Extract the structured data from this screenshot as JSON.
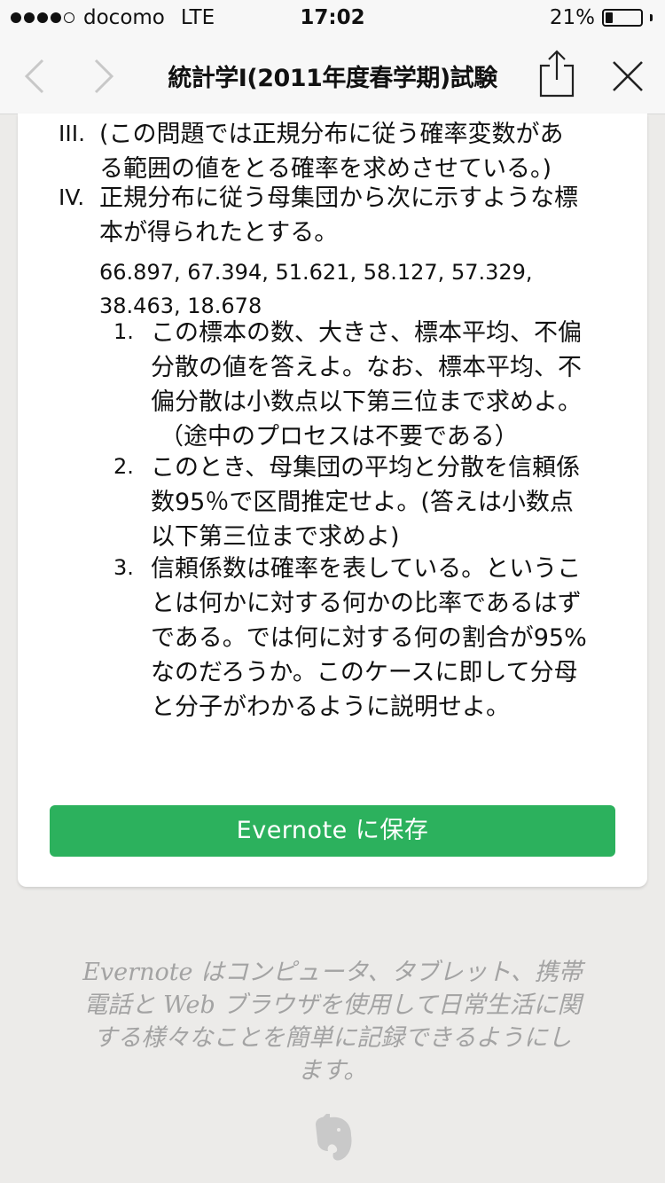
{
  "status_bar": {
    "carrier": "docomo",
    "network": "LTE",
    "time": "17:02",
    "battery_percent": "21%",
    "battery_level": 0.21,
    "signal_bars": 4,
    "signal_total": 5
  },
  "nav": {
    "title": "統計学I(2011年度春学期)試験"
  },
  "items": {
    "iii": {
      "label": "III.",
      "lines": [
        "(この問題では正規分布に従う確率変数があ",
        "る範囲の値をとる確率を求めさせている。)"
      ]
    },
    "iv": {
      "label": "IV.",
      "lines": [
        "正規分布に従う母集団から次に示すような標",
        "本が得られたとする。"
      ],
      "samples": [
        "66.897, 67.394, 51.621, 58.127, 57.329,",
        "38.463, 18.678"
      ],
      "sub": [
        {
          "label": "1.",
          "lines": [
            "この標本の数、大きさ、標本平均、不偏",
            "分散の値を答えよ。なお、標本平均、不",
            "偏分散は小数点以下第三位まで求めよ。",
            "（途中のプロセスは不要である）"
          ]
        },
        {
          "label": "2.",
          "lines": [
            "このとき、母集団の平均と分散を信頼係",
            "数95％で区間推定せよ。(答えは小数点",
            "以下第三位まで求めよ)"
          ]
        },
        {
          "label": "3.",
          "lines": [
            "信頼係数は確率を表している。というこ",
            "とは何かに対する何かの比率であるはず",
            "である。では何に対する何の割合が95%",
            "なのだろうか。このケースに即して分母",
            "と分子がわかるように説明せよ。"
          ]
        }
      ]
    }
  },
  "save_button": {
    "label": "Evernote に保存"
  },
  "footer": {
    "lines": [
      "Evernote はコンピュータ、タブレット、携帯",
      "電話と Web ブラウザを使用して日常生活に関",
      "する様々なことを簡単に記録できるようにし",
      "ます。"
    ]
  },
  "colors": {
    "accent_green": "#2cb15d",
    "page_background": "#ecebe9",
    "footer_text": "#a3a3a3"
  },
  "icons": [
    "back-icon",
    "forward-icon",
    "share-icon",
    "close-icon",
    "evernote-elephant-icon"
  ]
}
